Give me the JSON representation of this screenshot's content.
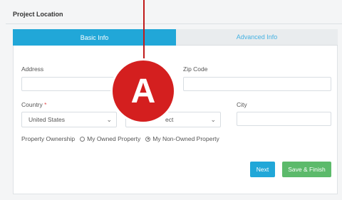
{
  "panel": {
    "title": "Project Location"
  },
  "tabs": {
    "basic": "Basic Info",
    "advanced": "Advanced Info"
  },
  "fields": {
    "address_label": "Address",
    "zip_label": "Zip Code",
    "country_label": "Country",
    "required_mark": "*",
    "country_value": "United States",
    "state_value": "ect",
    "city_label": "City"
  },
  "ownership": {
    "label": "Property Ownership",
    "options": [
      "My Owned Property",
      "My Non-Owned Property"
    ],
    "selected_index": 1
  },
  "buttons": {
    "next": "Next",
    "save_finish": "Save & Finish"
  },
  "annotation": {
    "marker_letter": "A"
  },
  "colors": {
    "tab_active": "#21a7d8",
    "button_next": "#21a7d8",
    "button_save": "#5cba6b",
    "marker": "#d41f1f"
  },
  "icons": {
    "select_arrow": "chevron-down-icon"
  }
}
